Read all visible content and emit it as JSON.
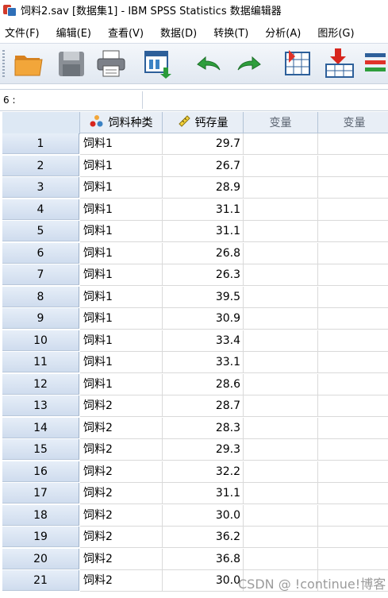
{
  "window": {
    "title": "饲料2.sav [数据集1] - IBM SPSS Statistics 数据编辑器"
  },
  "menu": [
    "文件(F)",
    "编辑(E)",
    "查看(V)",
    "数据(D)",
    "转换(T)",
    "分析(A)",
    "图形(G)"
  ],
  "toolbar": {
    "buttons": [
      "open-folder-icon",
      "save-icon",
      "print-icon",
      "recall-dialog-icon",
      "undo-icon",
      "redo-icon",
      "goto-case-icon",
      "insert-cases-icon",
      "insert-variable-icon"
    ]
  },
  "cell_editor": {
    "reference": "6 :",
    "value": ""
  },
  "columns": [
    {
      "label": "饲料种类",
      "icon": "nominal-variable-icon"
    },
    {
      "label": "钙存量",
      "icon": "scale-variable-icon"
    },
    {
      "label": "变量"
    },
    {
      "label": "变量"
    }
  ],
  "rows": [
    {
      "n": "1",
      "type": "饲料1",
      "value": "29.7"
    },
    {
      "n": "2",
      "type": "饲料1",
      "value": "26.7"
    },
    {
      "n": "3",
      "type": "饲料1",
      "value": "28.9"
    },
    {
      "n": "4",
      "type": "饲料1",
      "value": "31.1"
    },
    {
      "n": "5",
      "type": "饲料1",
      "value": "31.1"
    },
    {
      "n": "6",
      "type": "饲料1",
      "value": "26.8"
    },
    {
      "n": "7",
      "type": "饲料1",
      "value": "26.3"
    },
    {
      "n": "8",
      "type": "饲料1",
      "value": "39.5"
    },
    {
      "n": "9",
      "type": "饲料1",
      "value": "30.9"
    },
    {
      "n": "10",
      "type": "饲料1",
      "value": "33.4"
    },
    {
      "n": "11",
      "type": "饲料1",
      "value": "33.1"
    },
    {
      "n": "12",
      "type": "饲料1",
      "value": "28.6"
    },
    {
      "n": "13",
      "type": "饲料2",
      "value": "28.7"
    },
    {
      "n": "14",
      "type": "饲料2",
      "value": "28.3"
    },
    {
      "n": "15",
      "type": "饲料2",
      "value": "29.3"
    },
    {
      "n": "16",
      "type": "饲料2",
      "value": "32.2"
    },
    {
      "n": "17",
      "type": "饲料2",
      "value": "31.1"
    },
    {
      "n": "18",
      "type": "饲料2",
      "value": "30.0"
    },
    {
      "n": "19",
      "type": "饲料2",
      "value": "36.2"
    },
    {
      "n": "20",
      "type": "饲料2",
      "value": "36.8"
    },
    {
      "n": "21",
      "type": "饲料2",
      "value": "30.0"
    }
  ],
  "watermark": "CSDN @ !continue!博客"
}
